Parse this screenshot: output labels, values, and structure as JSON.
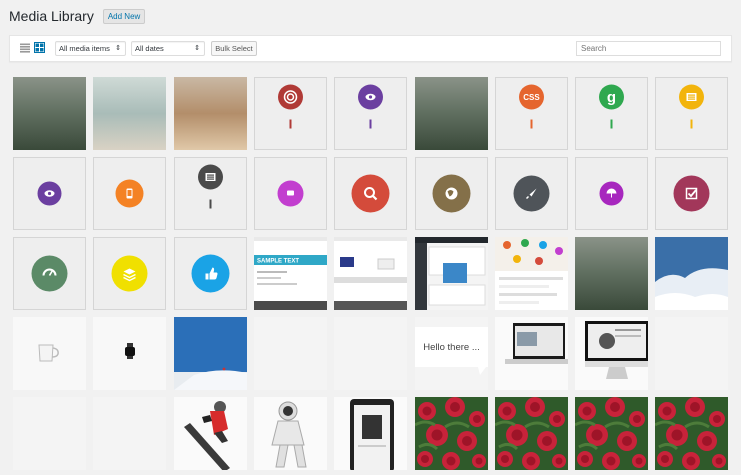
{
  "header": {
    "title": "Media Library",
    "add_new_label": "Add New"
  },
  "toolbar": {
    "media_type": "All media items",
    "date": "All dates",
    "bulk_select_label": "Bulk Select",
    "search_placeholder": "Search"
  },
  "colors": {
    "link_blue": "#0073aa",
    "target_red": "#b03a36",
    "eye_purple": "#6b3fa0",
    "css_orange": "#e5652e",
    "google_green": "#2fa84f",
    "doc_yellow": "#f2b40c",
    "cyan": "#1ce3d5",
    "phone_orange": "#f48224",
    "dark_gray": "#4a4a4a",
    "magenta": "#c23ecf",
    "search_red": "#d44b3b",
    "globe_olive": "#847049",
    "rocket_slate": "#4f5459",
    "umbrella_purple": "#a727be",
    "check_maroon": "#a2375a",
    "gauge_green": "#5b8a67",
    "layers_yellow": "#f0e000",
    "hand_blue": "#1aa3e6"
  },
  "tiles": [
    {
      "kind": "photo",
      "icon": "blurred-photo"
    },
    {
      "kind": "photo",
      "icon": "blurred-photo"
    },
    {
      "kind": "photo",
      "icon": "blurred-photo"
    },
    {
      "kind": "pin",
      "icon": "target-icon"
    },
    {
      "kind": "pin",
      "icon": "eye-icon"
    },
    {
      "kind": "photo",
      "icon": "blurred-photo"
    },
    {
      "kind": "pin",
      "icon": "css-icon",
      "text": "CSS"
    },
    {
      "kind": "pin",
      "icon": "google-icon",
      "text": "g"
    },
    {
      "kind": "pin",
      "icon": "document-list-icon"
    },
    {
      "kind": "circle",
      "icon": "eye-icon"
    },
    {
      "kind": "circle",
      "icon": "smartphone-icon"
    },
    {
      "kind": "pin",
      "icon": "list-icon"
    },
    {
      "kind": "circle",
      "icon": "chat-bubble-icon"
    },
    {
      "kind": "circle",
      "icon": "search-icon"
    },
    {
      "kind": "circle",
      "icon": "globe-icon"
    },
    {
      "kind": "circle",
      "icon": "rocket-icon"
    },
    {
      "kind": "circle",
      "icon": "umbrella-icon"
    },
    {
      "kind": "circle",
      "icon": "checkbox-icon"
    },
    {
      "kind": "circle",
      "icon": "gauge-icon"
    },
    {
      "kind": "circle",
      "icon": "layers-icon"
    },
    {
      "kind": "circle",
      "icon": "thumbs-up-icon"
    },
    {
      "kind": "screenshot",
      "icon": "webpage-screenshot",
      "text": "SAMPLE TEXT"
    },
    {
      "kind": "screenshot",
      "icon": "webpage-screenshot"
    },
    {
      "kind": "screenshot",
      "icon": "dashboard-screenshot"
    },
    {
      "kind": "screenshot",
      "icon": "app-icons-screenshot"
    },
    {
      "kind": "photo",
      "icon": "blurred-photo"
    },
    {
      "kind": "photo",
      "icon": "clouds-photo"
    },
    {
      "kind": "object",
      "icon": "mug-icon"
    },
    {
      "kind": "object",
      "icon": "watch-icon"
    },
    {
      "kind": "photo",
      "icon": "skier-photo"
    },
    {
      "kind": "blank",
      "icon": "blank-image"
    },
    {
      "kind": "blank",
      "icon": "blank-image"
    },
    {
      "kind": "speech",
      "icon": "speech-bubble-icon",
      "text": "Hello there ..."
    },
    {
      "kind": "device",
      "icon": "laptop-icon"
    },
    {
      "kind": "device",
      "icon": "imac-icon"
    },
    {
      "kind": "blank",
      "icon": "blank-image"
    },
    {
      "kind": "blank",
      "icon": "blank-image"
    },
    {
      "kind": "blank",
      "icon": "blank-image"
    },
    {
      "kind": "photo",
      "icon": "snowboarder-photo"
    },
    {
      "kind": "photo",
      "icon": "astronaut-photo"
    },
    {
      "kind": "device",
      "icon": "tablet-icon"
    },
    {
      "kind": "photo",
      "icon": "roses-photo"
    },
    {
      "kind": "photo",
      "icon": "roses-photo"
    },
    {
      "kind": "photo",
      "icon": "roses-photo"
    },
    {
      "kind": "photo",
      "icon": "roses-photo"
    }
  ]
}
